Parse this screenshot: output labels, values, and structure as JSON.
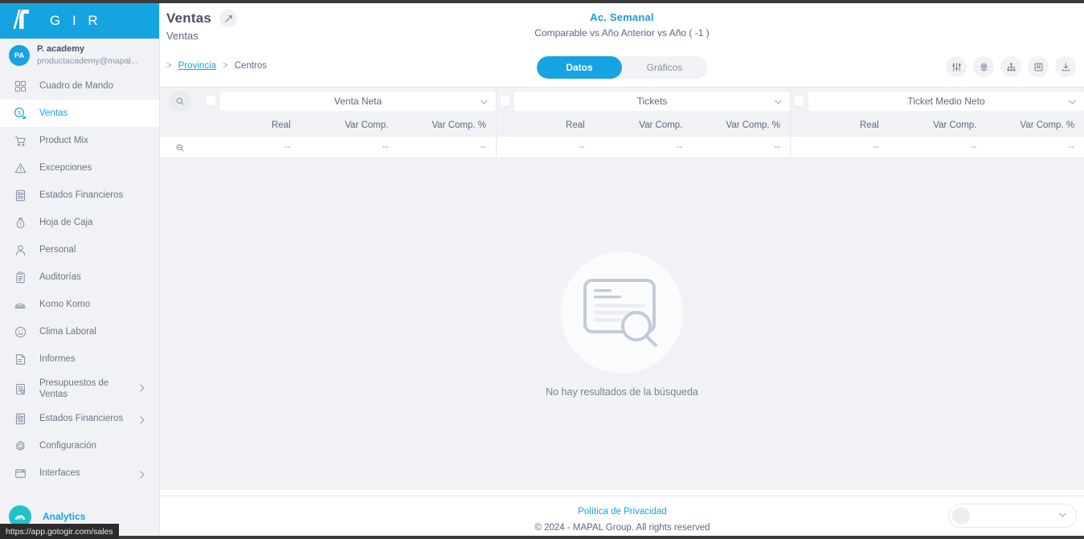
{
  "brand": {
    "name": "G I R",
    "logo_icon": "gir-logo-icon"
  },
  "user": {
    "initials": "PA",
    "name": "P. academy",
    "email": "productacademy@mapal..."
  },
  "sidebar": {
    "items": [
      {
        "label": "Cuadro de Mando",
        "icon": "dashboard-grid-icon",
        "active": false,
        "expandable": false
      },
      {
        "label": "Ventas",
        "icon": "sales-tag-icon",
        "active": true,
        "expandable": false
      },
      {
        "label": "Product Mix",
        "icon": "shopping-cart-icon",
        "active": false,
        "expandable": false
      },
      {
        "label": "Excepciones",
        "icon": "warning-triangle-icon",
        "active": false,
        "expandable": false
      },
      {
        "label": "Estados Financieros",
        "icon": "financial-document-icon",
        "active": false,
        "expandable": false
      },
      {
        "label": "Hoja de Caja",
        "icon": "money-bag-icon",
        "active": false,
        "expandable": false
      },
      {
        "label": "Personal",
        "icon": "person-icon",
        "active": false,
        "expandable": false
      },
      {
        "label": "Auditorías",
        "icon": "clipboard-icon",
        "active": false,
        "expandable": false
      },
      {
        "label": "Komo Komo",
        "icon": "komo-komo-icon",
        "active": false,
        "expandable": false
      },
      {
        "label": "Clima Laboral",
        "icon": "smiley-face-icon",
        "active": false,
        "expandable": false
      },
      {
        "label": "Informes",
        "icon": "report-icon",
        "active": false,
        "expandable": false
      },
      {
        "label": "Presupuestos de Ventas",
        "icon": "budget-document-icon",
        "active": false,
        "expandable": true
      },
      {
        "label": "Estados Financieros",
        "icon": "financial-document-icon",
        "active": false,
        "expandable": true
      },
      {
        "label": "Configuración",
        "icon": "gear-icon",
        "active": false,
        "expandable": false
      },
      {
        "label": "Interfaces",
        "icon": "window-icon",
        "active": false,
        "expandable": true
      }
    ],
    "analytics": {
      "label": "Analytics",
      "icon": "analytics-icon"
    }
  },
  "header": {
    "page_title": "Ventas",
    "expand_icon": "expand-arrow-icon",
    "section_label": "Ventas",
    "breadcrumb": [
      {
        "label": "",
        "link": true
      },
      {
        "label": "Provincia",
        "link": true
      },
      {
        "label": "Centros",
        "link": false
      }
    ],
    "breadcrumb_separator": ">",
    "report_title": "Ac. Semanal",
    "report_subtitle": "Comparable vs Año Anterior vs Año ( -1 )"
  },
  "tabs": [
    {
      "label": "Datos",
      "active": true
    },
    {
      "label": "Gráficos",
      "active": false
    }
  ],
  "toolbar_icons": [
    {
      "name": "filter-sliders-icon"
    },
    {
      "name": "location-pin-icon"
    },
    {
      "name": "hierarchy-icon"
    },
    {
      "name": "bookmark-icon"
    },
    {
      "name": "download-icon"
    }
  ],
  "table": {
    "search_icon": "search-icon",
    "zoom_out_icon": "search-minus-icon",
    "groups": [
      {
        "title": "Venta Neta",
        "chevron_icon": "chevron-down-icon",
        "columns": [
          "Real",
          "Var Comp.",
          "Var Comp. %"
        ],
        "values": [
          "--",
          "--",
          "--"
        ]
      },
      {
        "title": "Tickets",
        "chevron_icon": "chevron-down-icon",
        "columns": [
          "Real",
          "Var Comp.",
          "Var Comp. %"
        ],
        "values": [
          "--",
          "--",
          "--"
        ]
      },
      {
        "title": "Ticket Medio Neto",
        "chevron_icon": "chevron-down-icon",
        "columns": [
          "Real",
          "Var Comp.",
          "Var Comp. %"
        ],
        "values": [
          "--",
          "--",
          "--"
        ]
      }
    ]
  },
  "empty_state": {
    "icon": "no-results-icon",
    "message": "No hay resultados de la búsqueda"
  },
  "footer": {
    "privacy_link": "Política de Privacidad",
    "copyright": "© 2024 - MAPAL Group. All rights reserved",
    "selector_chevron_icon": "chevron-down-icon",
    "selector_value": ""
  },
  "statusbar": {
    "url": "https://app.gotogir.com/sales"
  },
  "colors": {
    "brand_blue": "#16a3e2",
    "accent_teal": "#21c2c9",
    "text_dark": "#4a5068",
    "text_muted": "#8a91a6",
    "panel_bg": "#f1f2f5"
  }
}
